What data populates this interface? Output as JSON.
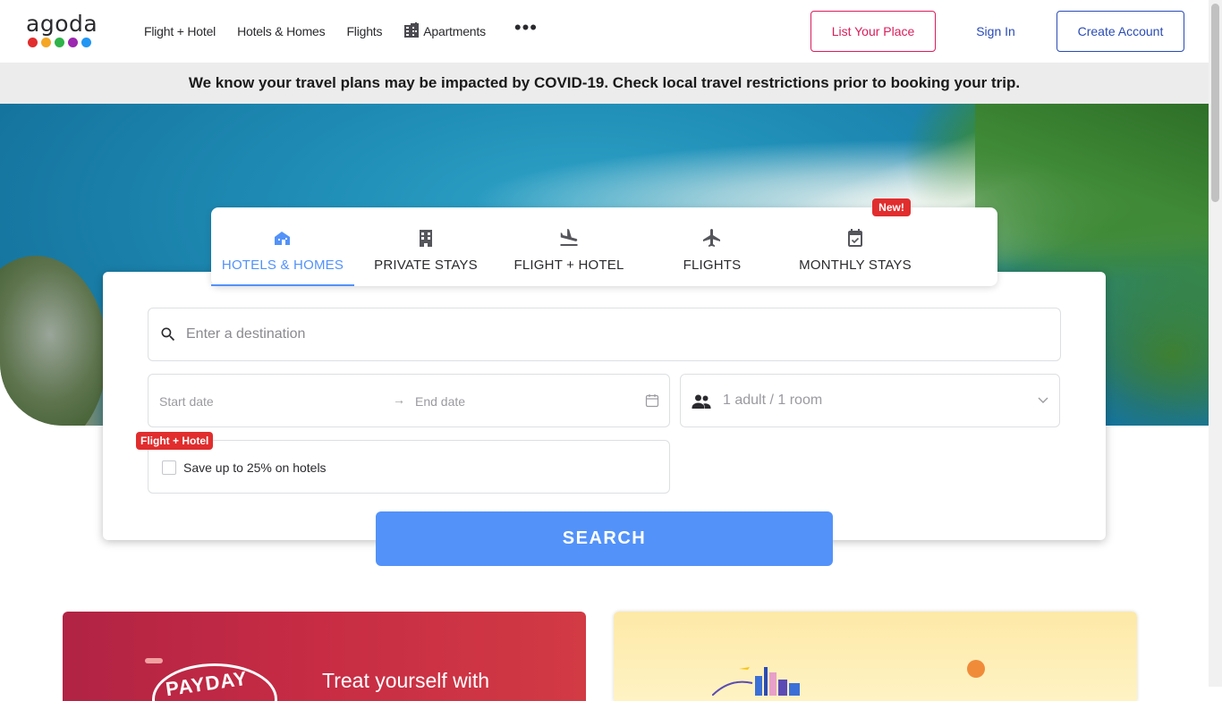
{
  "header": {
    "logo_text": "agoda",
    "logo_colors": [
      "#e12d2d",
      "#f5a623",
      "#2fb34a",
      "#9c27b0",
      "#2196f3"
    ],
    "nav": [
      {
        "label": "Flight + Hotel"
      },
      {
        "label": "Hotels & Homes"
      },
      {
        "label": "Flights"
      },
      {
        "label": "Apartments",
        "icon": "building-icon"
      }
    ],
    "more_label": "•••",
    "list_place": "List Your Place",
    "sign_in": "Sign In",
    "create_account": "Create Account"
  },
  "banner": {
    "text": "We know your travel plans may be impacted by COVID-19. Check local travel restrictions prior to booking your trip."
  },
  "tabs": [
    {
      "label": "HOTELS & HOMES",
      "icon": "house-icon",
      "active": true
    },
    {
      "label": "PRIVATE STAYS",
      "icon": "building-icon",
      "active": false
    },
    {
      "label": "FLIGHT + HOTEL",
      "icon": "plane-landing-icon",
      "active": false
    },
    {
      "label": "FLIGHTS",
      "icon": "plane-icon",
      "active": false
    },
    {
      "label": "MONTHLY STAYS",
      "icon": "calendar-check-icon",
      "active": false
    }
  ],
  "new_badge": "New!",
  "search": {
    "destination_placeholder": "Enter a destination",
    "start_date": "Start date",
    "arrow": "→",
    "end_date": "End date",
    "occupancy": "1 adult / 1 room",
    "promo_badge": "Flight + Hotel",
    "promo_text": "Save up to 25% on hotels",
    "button": "SEARCH"
  },
  "promos": {
    "left_brand": "PAYDAY",
    "left_text": "Treat yourself with",
    "right_text": ""
  },
  "colors": {
    "accent": "#5392f9",
    "brand_pink": "#d81e5b",
    "link_blue": "#2a4bb4",
    "badge_red": "#e12d2d"
  }
}
